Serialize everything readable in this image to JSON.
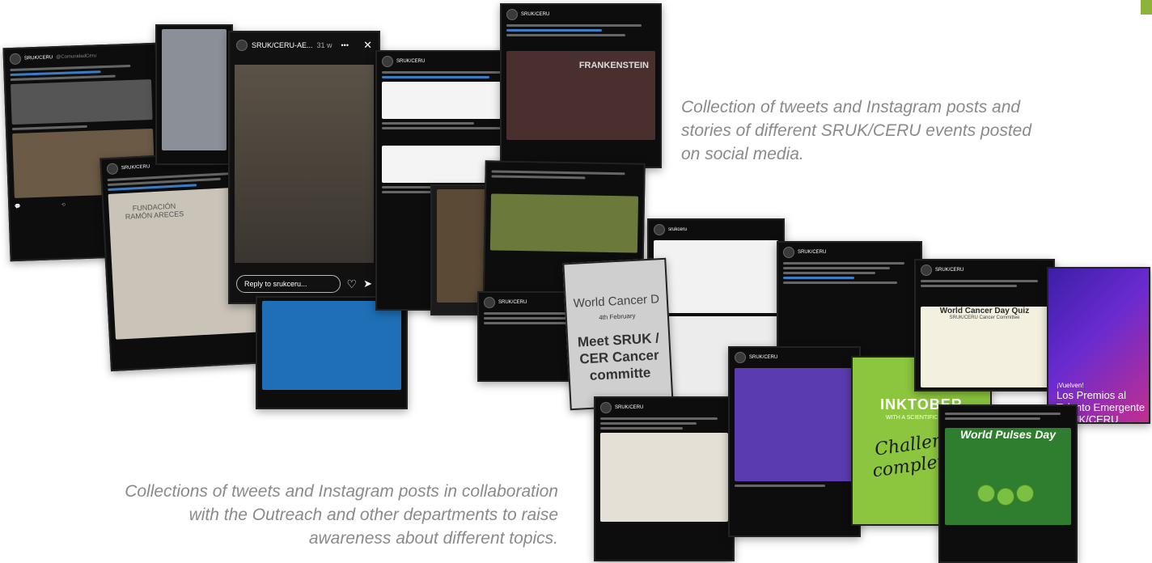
{
  "captions": {
    "top": "Collection of tweets and Instagram posts and stories of different SRUK/CERU events posted on social media.",
    "bottom": "Collections of tweets and Instagram posts in collaboration with the Outreach and other departments to raise awareness about different topics."
  },
  "story": {
    "account": "SRUK/CERU-AE...",
    "age": "31 w",
    "more": "•••",
    "close": "✕",
    "reply_placeholder": "Reply to srukceru...",
    "heart": "♡",
    "send": "➤"
  },
  "tweets": {
    "account": "SRUK/CERU",
    "handle": "@ComunidadCeru",
    "fundacion": "FUNDACIÓN RAMÓN ARECES"
  },
  "posts": {
    "world_cancer_day": "World Cancer D",
    "feb": "4th February",
    "meet": "Meet SRUK / CER Cancer committe",
    "inktober": "INKTOBER",
    "scientific_tweet": "WITH A SCIENTIFIC TWIST",
    "challenge": "Challenge completed!",
    "premios_small": "¡Vuelven!",
    "premios": "Los Premios al Talento Emergente SRUK/CERU",
    "quiz": "World Cancer Day Quiz",
    "quiz_by": "SRUK/CERU Cancer Committee",
    "pulses": "World Pulses Day",
    "frankenstein": "FRANKENSTEIN"
  },
  "colors": {
    "accent": "#8db33a",
    "caption": "#8a8a8a",
    "twitter_link": "#3c7cc4"
  }
}
